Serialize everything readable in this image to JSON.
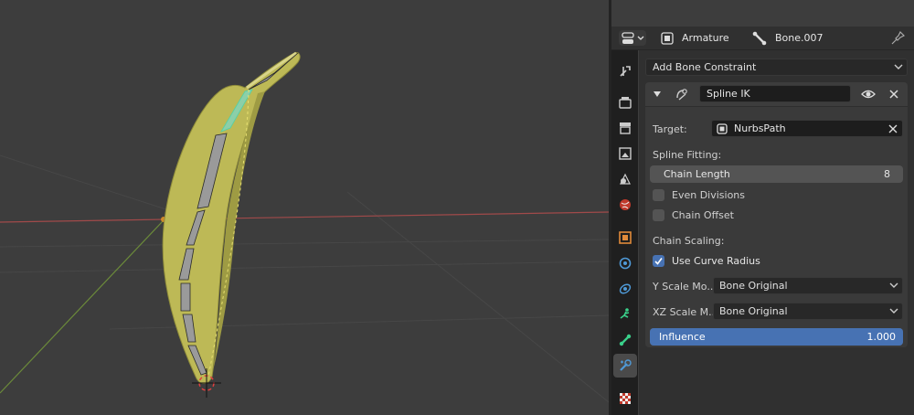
{
  "header": {
    "editor_type_icon": "properties-editor-icon",
    "object_name": "Armature",
    "bone_name": "Bone.007",
    "pin_icon": "pin-icon"
  },
  "tabs": [
    "tool-icon",
    "render-icon",
    "output-icon",
    "view-layer-icon",
    "scene-icon",
    "world-icon",
    "object-icon",
    "modifier-icon",
    "particles-icon",
    "physics-icon",
    "bone-icon",
    "bone-constraint-icon",
    "texture-icon"
  ],
  "add_constraint": {
    "label": "Add Bone Constraint"
  },
  "constraint": {
    "name": "Spline IK",
    "target_label": "Target:",
    "target_value": "NurbsPath",
    "spline_fitting_label": "Spline Fitting:",
    "chain_length_label": "Chain Length",
    "chain_length_value": "8",
    "even_divisions_label": "Even Divisions",
    "even_divisions_checked": false,
    "chain_offset_label": "Chain Offset",
    "chain_offset_checked": false,
    "chain_scaling_label": "Chain Scaling:",
    "use_curve_radius_label": "Use Curve Radius",
    "use_curve_radius_checked": true,
    "y_scale_label": "Y Scale Mo...",
    "y_scale_value": "Bone Original",
    "xz_scale_label": "XZ Scale M...",
    "xz_scale_value": "Bone Original",
    "influence_label": "Influence",
    "influence_value": "1.000",
    "influence_fraction": 1.0
  },
  "colors": {
    "accent": "#4772b3",
    "panel": "#303030",
    "viewport": "#3d3d3d",
    "banana": "#c7c35a",
    "x_axis": "#a14a4a",
    "y_axis": "#6b8a3a"
  }
}
